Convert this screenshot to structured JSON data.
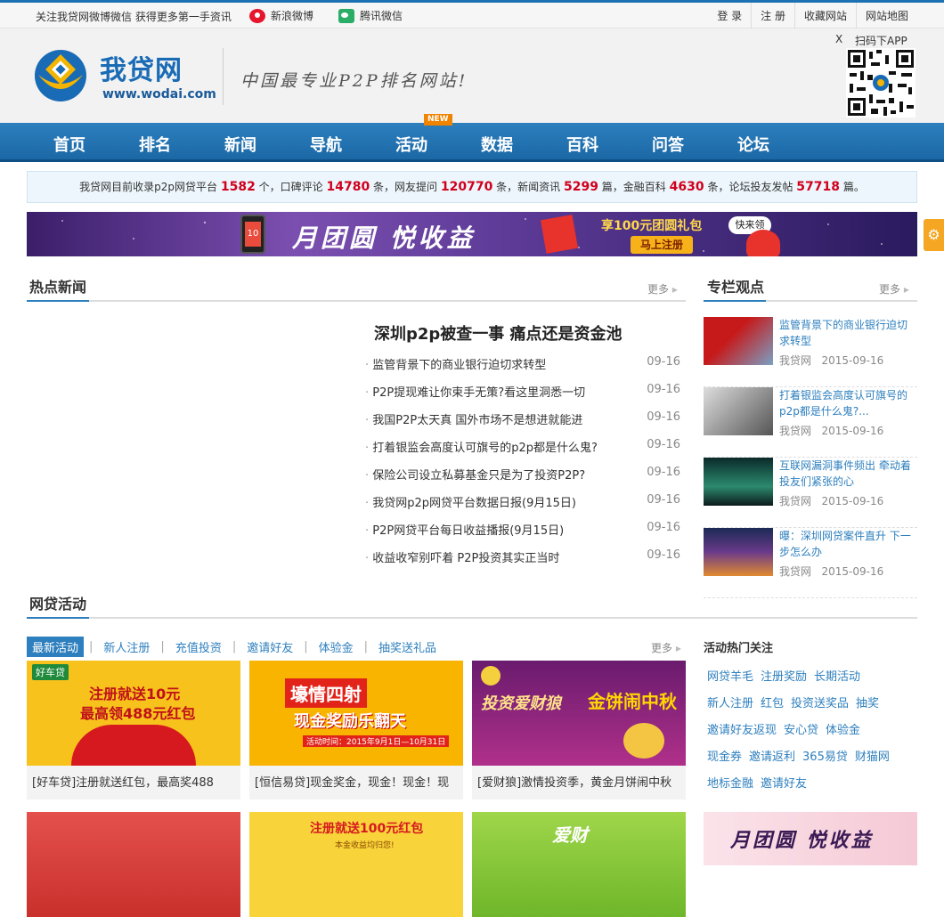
{
  "topbar": {
    "notice": "关注我贷网微博微信 获得更多第一手资讯",
    "weibo": "新浪微博",
    "weixin": "腾讯微信",
    "links": [
      "登 录",
      "注 册",
      "收藏网站",
      "网站地图"
    ]
  },
  "header": {
    "logo_text": "我贷网",
    "logo_url": "www.wodai.com",
    "slogan": "中国最专业P2P排名网站!",
    "qr_close": "X",
    "qr_label": "扫码下APP"
  },
  "nav": {
    "items": [
      "首页",
      "排名",
      "新闻",
      "导航",
      "活动",
      "数据",
      "百科",
      "问答",
      "论坛"
    ],
    "badge": "NEW"
  },
  "stats": {
    "p1": "我贷网目前收录p2p网贷平台",
    "v1": "1582",
    "p2": "个，口碑评论",
    "v2": "14780",
    "p3": "条，网友提问",
    "v3": "120770",
    "p4": "条，新闻资讯",
    "v4": "5299",
    "p5": "篇，金融百科",
    "v5": "4630",
    "p6": "条，论坛投友发帖",
    "v6": "57718",
    "p7": "篇。"
  },
  "banner": {
    "text": "月团圆 悦收益",
    "badge": "享100元团圆礼包",
    "cta": "马上注册",
    "bubble": "快来领",
    "phone_num": "10"
  },
  "hot_news": {
    "title": "热点新闻",
    "more": "更多",
    "lead": "深圳p2p被查一事 痛点还是资金池",
    "items": [
      {
        "title": "监管背景下的商业银行迫切求转型",
        "date": "09-16"
      },
      {
        "title": "P2P提现难让你束手无策?看这里洞悉一切",
        "date": "09-16"
      },
      {
        "title": "我国P2P太天真 国外市场不是想进就能进",
        "date": "09-16"
      },
      {
        "title": "打着银监会高度认可旗号的p2p都是什么鬼?",
        "date": "09-16"
      },
      {
        "title": "保险公司设立私募基金只是为了投资P2P?",
        "date": "09-16"
      },
      {
        "title": "我贷网p2p网贷平台数据日报(9月15日)",
        "date": "09-16"
      },
      {
        "title": "P2P网贷平台每日收益播报(9月15日)",
        "date": "09-16"
      },
      {
        "title": "收益收窄别吓着 P2P投资其实正当时",
        "date": "09-16"
      }
    ]
  },
  "column": {
    "title": "专栏观点",
    "more": "更多",
    "items": [
      {
        "title": "监管背景下的商业银行迫切求转型",
        "source": "我贷网",
        "date": "2015-09-16"
      },
      {
        "title": "打着银监会高度认可旗号的p2p都是什么鬼?...",
        "source": "我贷网",
        "date": "2015-09-16"
      },
      {
        "title": "互联网漏洞事件频出 牵动着投友们紧张的心",
        "source": "我贷网",
        "date": "2015-09-16"
      },
      {
        "title": "曝：深圳网贷案件直升 下一步怎么办",
        "source": "我贷网",
        "date": "2015-09-16"
      }
    ]
  },
  "activity": {
    "title": "网贷活动",
    "more": "更多",
    "tabs": [
      "最新活动",
      "新人注册",
      "充值投资",
      "邀请好友",
      "体验金",
      "抽奖送礼品"
    ],
    "cards": [
      {
        "caption": "[好车贷]注册就送红包，最高奖488",
        "brand": "好车贷",
        "line1": "注册就送10元",
        "line2": "最高领488元红包"
      },
      {
        "caption": "[恒信易贷]现金奖金，现金！现金！现",
        "line1": "壕情四射",
        "line2": "现金奖励乐翻天",
        "sub": "活动时间：2015年9月1日—10月31日"
      },
      {
        "caption": "[爱财狼]激情投资季，黄金月饼闹中秋",
        "line1": "投资爱财狼",
        "line2": "金饼闹中秋"
      },
      {
        "line1": "",
        "line2": ""
      },
      {
        "line1": "注册就送100元红包",
        "line2": "本金收益均归您!"
      },
      {
        "line1": "爱财",
        "line2": ""
      }
    ],
    "hot_title": "活动热门关注",
    "hot_tags": [
      [
        "网贷羊毛",
        "注册奖励",
        "长期活动"
      ],
      [
        "新人注册",
        "红包",
        "投资送奖品",
        "抽奖"
      ],
      [
        "邀请好友返现",
        "安心贷",
        "体验金"
      ],
      [
        "现金券",
        "邀请返利",
        "365易贷",
        "财猫网"
      ],
      [
        "地标金融",
        "邀请好友"
      ]
    ],
    "side_banner": "月团圆 悦收益"
  }
}
